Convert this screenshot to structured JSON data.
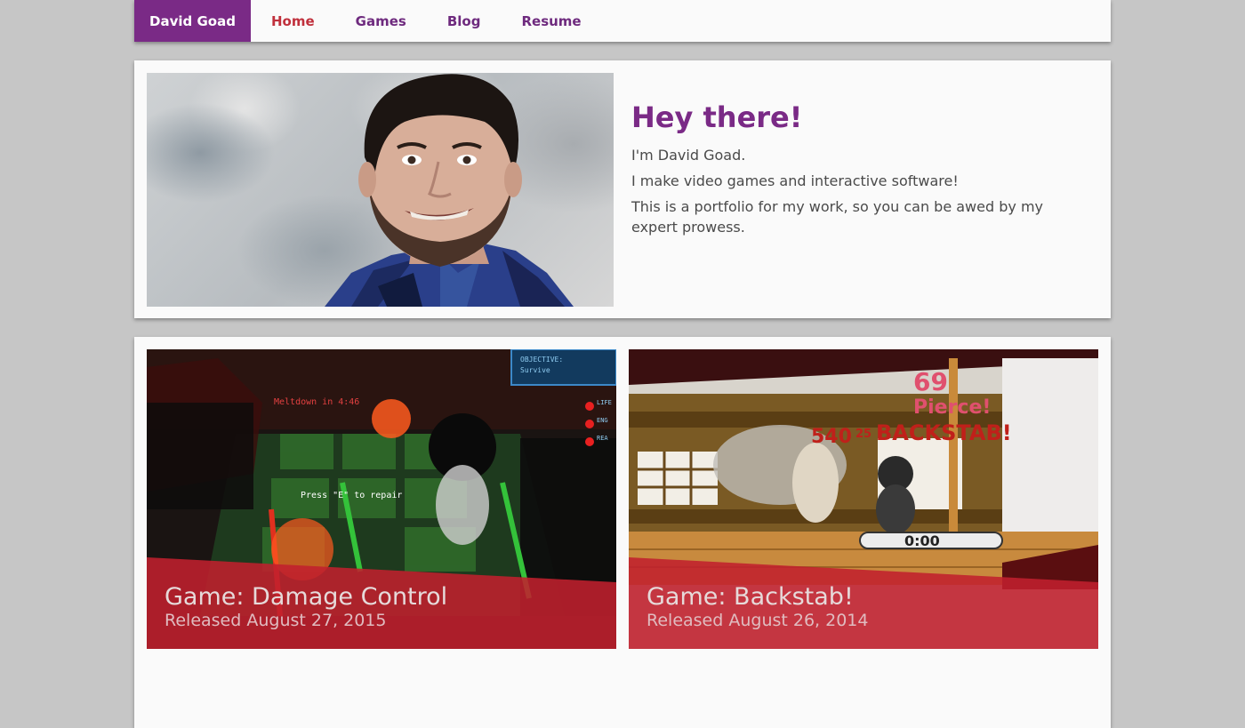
{
  "nav": {
    "brand": "David Goad",
    "items": [
      {
        "label": "Home",
        "active": true
      },
      {
        "label": "Games",
        "active": false
      },
      {
        "label": "Blog",
        "active": false
      },
      {
        "label": "Resume",
        "active": false
      }
    ]
  },
  "hero": {
    "title": "Hey there!",
    "lines": [
      "I'm David Goad.",
      "I make video games and interactive software!",
      "This is a portfolio for my work, so you can be awed by my expert prowess."
    ]
  },
  "games": [
    {
      "title": "Game: Damage Control",
      "released": "Released August 27, 2015",
      "hud": {
        "objective_title": "OBJECTIVE:",
        "objective": "Survive",
        "alert": "Meltdown in 4:46",
        "prompt": "Press \"E\" to repair",
        "stats": [
          "LIFE",
          "ENG",
          "REA"
        ]
      }
    },
    {
      "title": "Game: Backstab!",
      "released": "Released August 26, 2014",
      "hud": {
        "combo": "69",
        "pierce": "Pierce!",
        "score": "540",
        "score_suffix": "25",
        "backstab": "BACKSTAB!",
        "timer": "0:00"
      }
    }
  ],
  "colors": {
    "brand": "#7a2a86",
    "active_nav": "#c0303c",
    "band": "#c0202e"
  }
}
